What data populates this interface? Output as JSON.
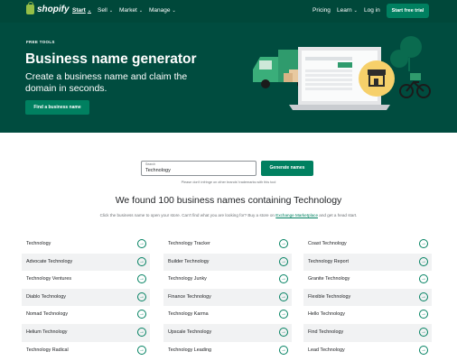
{
  "nav": {
    "logo_text": "shopify",
    "links": [
      {
        "label": "Start",
        "chevron": "⌄"
      },
      {
        "label": "Sell",
        "chevron": "⌄"
      },
      {
        "label": "Market",
        "chevron": "⌄"
      },
      {
        "label": "Manage",
        "chevron": "⌄"
      }
    ],
    "pricing": "Pricing",
    "learn": "Learn",
    "learn_chevron": "⌄",
    "login": "Log in",
    "cta": "Start free trial"
  },
  "hero": {
    "eyebrow": "FREE TOOLS",
    "title": "Business name generator",
    "subtitle": "Create a business name and claim the domain in seconds.",
    "button": "Find a business name"
  },
  "search": {
    "label": "Search",
    "value": "Technology",
    "button": "Generate names",
    "disclaimer": "Please don't infringe on other brands' trademarks with this tool"
  },
  "results": {
    "heading": "We found 100 business names containing Technology",
    "sub_before": "Click the business name to open your store. Can't find what you are looking for? Buy a store on ",
    "sub_link": "Exchange Marketplace",
    "sub_after": " and get a head start.",
    "columns": [
      [
        "Technology",
        "Advocate Technology",
        "Technology Ventures",
        "Diablo Technology",
        "Nomad Technology",
        "Helium Technology",
        "Technology Radical"
      ],
      [
        "Technology Tracker",
        "Builder Technology",
        "Technology Junky",
        "Finance Technology",
        "Technology Karma",
        "Upscale Technology",
        "Technology Leading"
      ],
      [
        "Coast Technology",
        "Technology Report",
        "Granite Technology",
        "Flexible Technology",
        "Hello Technology",
        "Find Technology",
        "Lead Technology"
      ]
    ],
    "arrow_icon": "→"
  },
  "colors": {
    "nav_bg": "#00483a",
    "hero_bg": "#004c3f",
    "accent": "#008060",
    "logo_green": "#95bf47",
    "badge_yellow": "#f6d06a"
  }
}
